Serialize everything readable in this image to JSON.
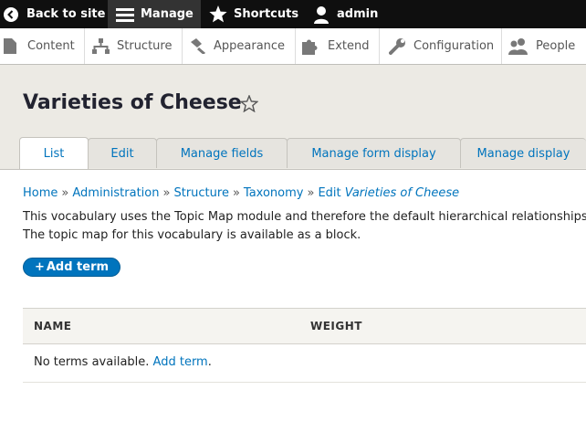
{
  "toolbar": {
    "back_label": "Back to site",
    "manage_label": "Manage",
    "shortcuts_label": "Shortcuts",
    "user_label": "admin"
  },
  "tray": {
    "items": [
      {
        "label": "Content",
        "icon": "content-icon"
      },
      {
        "label": "Structure",
        "icon": "structure-icon"
      },
      {
        "label": "Appearance",
        "icon": "appearance-icon"
      },
      {
        "label": "Extend",
        "icon": "extend-icon"
      },
      {
        "label": "Configuration",
        "icon": "configuration-icon"
      },
      {
        "label": "People",
        "icon": "people-icon"
      }
    ]
  },
  "page": {
    "title": "Varieties of Cheese"
  },
  "tabs": [
    "List",
    "Edit",
    "Manage fields",
    "Manage form display",
    "Manage display"
  ],
  "breadcrumb": {
    "items": [
      "Home",
      "Administration",
      "Structure",
      "Taxonomy"
    ],
    "separator": "»",
    "current_prefix": "Edit",
    "current_emphasis": "Varieties of Cheese"
  },
  "description": {
    "line1": "This vocabulary uses the Topic Map module and therefore the default hierarchical relationships",
    "line2": "The topic map for this vocabulary is available as a block."
  },
  "actions": {
    "add_term_plus": "+",
    "add_term_label": "Add term"
  },
  "table": {
    "headers": [
      "NAME",
      "WEIGHT"
    ],
    "empty_text": "No terms available.",
    "empty_link": "Add term",
    "empty_suffix": "."
  },
  "colors": {
    "toolbar_bg": "#0f0f0f",
    "link": "#0074bd",
    "header_bg": "#eceae4"
  }
}
